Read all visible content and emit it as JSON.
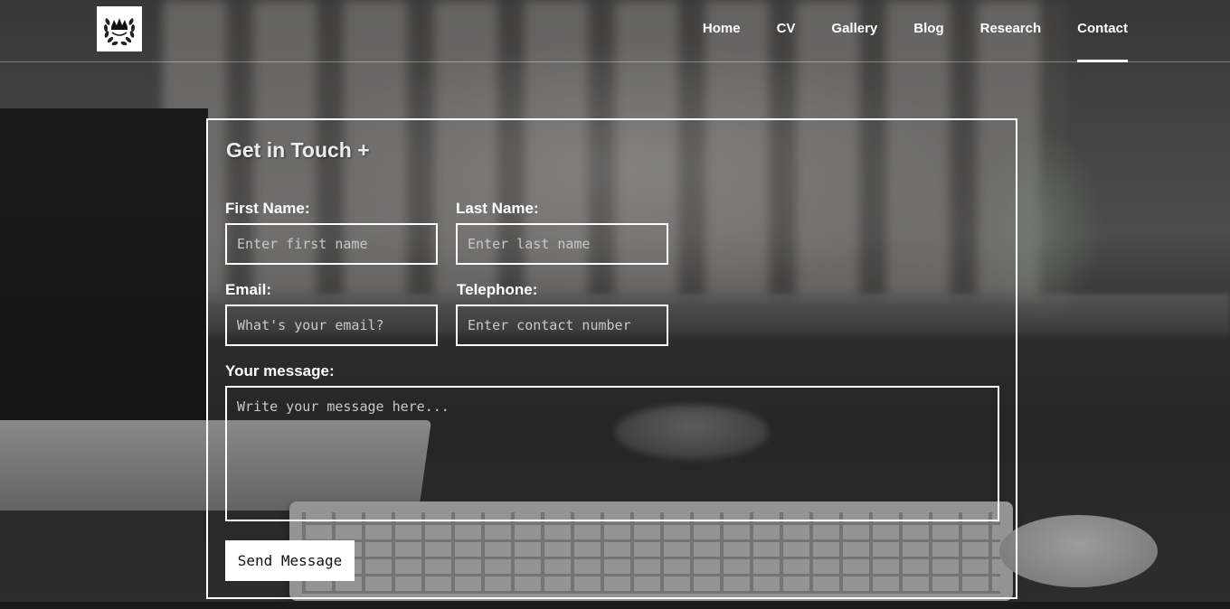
{
  "header": {
    "logo_icon": "laurel-crown-icon",
    "nav": [
      {
        "label": "Home",
        "active": false
      },
      {
        "label": "CV",
        "active": false
      },
      {
        "label": "Gallery",
        "active": false
      },
      {
        "label": "Blog",
        "active": false
      },
      {
        "label": "Research",
        "active": false
      },
      {
        "label": "Contact",
        "active": true
      }
    ]
  },
  "form": {
    "title": "Get in Touch +",
    "first_name": {
      "label": "First Name:",
      "placeholder": "Enter first name",
      "value": ""
    },
    "last_name": {
      "label": "Last Name:",
      "placeholder": "Enter last name",
      "value": ""
    },
    "email": {
      "label": "Email:",
      "placeholder": "What's your email?",
      "value": ""
    },
    "telephone": {
      "label": "Telephone:",
      "placeholder": "Enter contact number",
      "value": ""
    },
    "message": {
      "label": "Your message:",
      "placeholder": "Write your message here...",
      "value": ""
    },
    "submit_label": "Send Message"
  },
  "colors": {
    "border": "#ffffff",
    "text": "#ffffff",
    "placeholder": "#c9c9c9",
    "button_bg": "#ffffff",
    "button_text": "#111111"
  }
}
